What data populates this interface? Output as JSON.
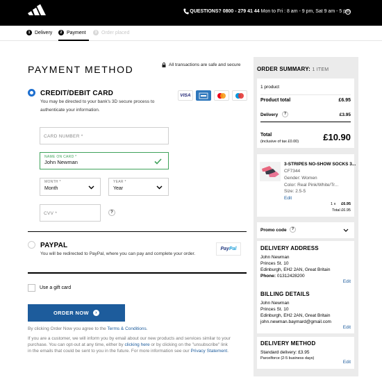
{
  "header": {
    "logo_text": "adidas",
    "questions_label": "QUESTIONS? 0800 - 279 41 44",
    "hours": " Mon to Fri : 8 am - 9 pm, Sat 9 am - 5 pm"
  },
  "steps": [
    {
      "num": "1",
      "label": "Delivery"
    },
    {
      "num": "2",
      "label": "Payment"
    },
    {
      "num": "3",
      "label": "Order placed"
    }
  ],
  "payment": {
    "title": "PAYMENT METHOD",
    "secure_text": "All transactions are safe and secure",
    "card_option": {
      "title": "CREDIT/DEBIT CARD",
      "desc_line1": "You may be directed to your bank's 3D secure process to",
      "desc_line2": "authenticate your information.",
      "logos": [
        "VISA",
        "AMEX",
        "MC",
        "MAESTRO"
      ]
    },
    "card_number_placeholder": "CARD NUMBER *",
    "name_label": "NAME ON CARD *",
    "name_value": "John Newman",
    "month_label": "MONTH *",
    "month_value": "Month",
    "year_label": "YEAR *",
    "year_value": "Year",
    "cvv_placeholder": "CVV *",
    "help": "?",
    "paypal_option": {
      "title": "PAYPAL",
      "desc": "You will be redirected to PayPal, where you can pay and complete your order.",
      "badge_pay": "Pay",
      "badge_pal": "Pal"
    },
    "gift_card_label": "Use a gift card",
    "order_button": "ORDER NOW",
    "terms_prefix": "By clicking Order Now you agree to the ",
    "terms_link": "Terms & Conditions",
    "terms_suffix": ".",
    "notice_line1": "If you are a customer, we will inform you by email about our new products and services similar to your",
    "notice_line2_a": "purchase. You can opt-out at any time, either by ",
    "notice_line2_link": "clicking here",
    "notice_line2_b": " or by clicking on the \"unsubscribe\" link",
    "notice_line3_a": "in the emails that could be sent to you in the future. For more information see our ",
    "notice_line3_link": "Privacy Statement",
    "notice_line3_b": "."
  },
  "summary": {
    "title": "ORDER SUMMARY:",
    "item_count_label": "1 ITEM",
    "product_count": "1 product",
    "product_total_label": "Product total",
    "product_total_value": "£6.95",
    "delivery_label": "Delivery",
    "delivery_value": "£3.95",
    "total_label": "Total",
    "total_sub": "(inclusive of tax £0.00)",
    "total_value": "£10.90",
    "item": {
      "name": "3-STRIPES NO-SHOW SOCKS 3...",
      "code": "CF7344",
      "gender": "Gender: Women",
      "color": "Color: Real Pink/White/Tr...",
      "size": "Size: 2.5-5",
      "edit": "Edit",
      "qty_line": "1 x",
      "unit_price": "£6.95",
      "total_line": "Total £6.95"
    },
    "promo_label": "Promo code",
    "delivery_address": {
      "title": "DELIVERY ADDRESS",
      "name": "John Newman",
      "street": "Princes St. 10",
      "city": "Edinburgh, EH2 2AN, Great Britain",
      "phone_label": "Phone:",
      "phone": " 01312428200",
      "edit": "Edit"
    },
    "billing": {
      "title": "BILLING DETAILS",
      "name": "John Newman",
      "street": "Princes St. 10",
      "city": "Edinburgh, EH2 2AN, Great Britain",
      "email": "john.newman.baymard@gmail.com",
      "edit": "Edit"
    },
    "delivery_method": {
      "title": "DELIVERY METHOD",
      "standard": "Standard delivery: £3.95",
      "carrier": "Parcelforce (2-5 business days)",
      "edit": "Edit"
    }
  },
  "colors": {
    "accent_blue": "#1d5c9c",
    "radio_blue": "#1e6fcf",
    "valid_green": "#3fa25a"
  }
}
